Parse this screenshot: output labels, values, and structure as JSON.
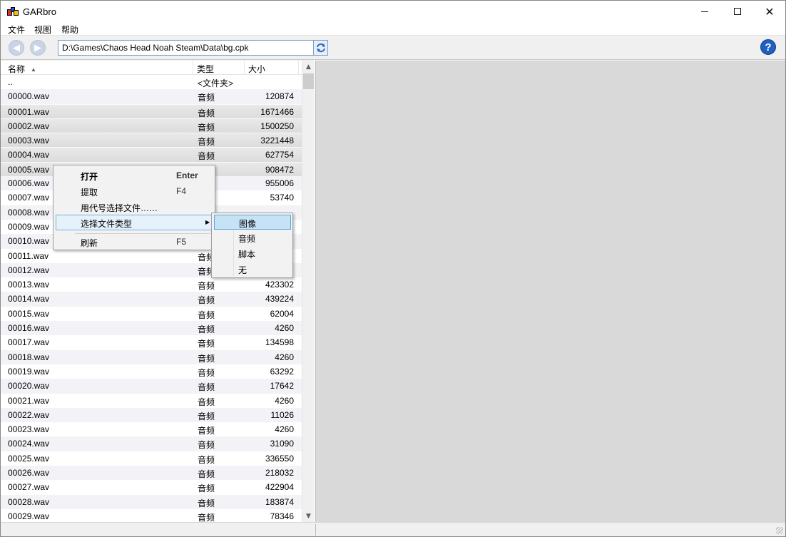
{
  "window": {
    "title": "GARbro"
  },
  "menubar": {
    "file": "文件",
    "view": "视图",
    "help": "帮助"
  },
  "toolbar": {
    "path": "D:\\Games\\Chaos Head Noah Steam\\Data\\bg.cpk"
  },
  "list": {
    "headers": {
      "name": "名称",
      "type": "类型",
      "size": "大小"
    },
    "rows": [
      {
        "name": "..",
        "type": "<文件夹>",
        "size": ""
      },
      {
        "name": "00000.wav",
        "type": "音频",
        "size": "120874"
      },
      {
        "name": "00001.wav",
        "type": "音频",
        "size": "1671466"
      },
      {
        "name": "00002.wav",
        "type": "音频",
        "size": "1500250"
      },
      {
        "name": "00003.wav",
        "type": "音频",
        "size": "3221448"
      },
      {
        "name": "00004.wav",
        "type": "音频",
        "size": "627754"
      },
      {
        "name": "00005.wav",
        "type": "",
        "size": "908472"
      },
      {
        "name": "00006.wav",
        "type": "",
        "size": "955006"
      },
      {
        "name": "00007.wav",
        "type": "",
        "size": "53740"
      },
      {
        "name": "00008.wav",
        "type": "",
        "size": ""
      },
      {
        "name": "00009.wav",
        "type": "",
        "size": ""
      },
      {
        "name": "00010.wav",
        "type": "",
        "size": ""
      },
      {
        "name": "00011.wav",
        "type": "音频",
        "size": ""
      },
      {
        "name": "00012.wav",
        "type": "音频",
        "size": ""
      },
      {
        "name": "00013.wav",
        "type": "音频",
        "size": "423302"
      },
      {
        "name": "00014.wav",
        "type": "音频",
        "size": "439224"
      },
      {
        "name": "00015.wav",
        "type": "音频",
        "size": "62004"
      },
      {
        "name": "00016.wav",
        "type": "音频",
        "size": "4260"
      },
      {
        "name": "00017.wav",
        "type": "音频",
        "size": "134598"
      },
      {
        "name": "00018.wav",
        "type": "音频",
        "size": "4260"
      },
      {
        "name": "00019.wav",
        "type": "音频",
        "size": "63292"
      },
      {
        "name": "00020.wav",
        "type": "音频",
        "size": "17642"
      },
      {
        "name": "00021.wav",
        "type": "音频",
        "size": "4260"
      },
      {
        "name": "00022.wav",
        "type": "音频",
        "size": "11026"
      },
      {
        "name": "00023.wav",
        "type": "音频",
        "size": "4260"
      },
      {
        "name": "00024.wav",
        "type": "音频",
        "size": "31090"
      },
      {
        "name": "00025.wav",
        "type": "音频",
        "size": "336550"
      },
      {
        "name": "00026.wav",
        "type": "音频",
        "size": "218032"
      },
      {
        "name": "00027.wav",
        "type": "音频",
        "size": "422904"
      },
      {
        "name": "00028.wav",
        "type": "音频",
        "size": "183874"
      },
      {
        "name": "00029.wav",
        "type": "音频",
        "size": "78346"
      }
    ]
  },
  "context_menu": {
    "open": "打开",
    "open_key": "Enter",
    "extract": "提取",
    "extract_key": "F4",
    "select_by_code": "用代号选择文件……",
    "select_type": "选择文件类型",
    "refresh": "刷新",
    "refresh_key": "F5"
  },
  "sub_menu": {
    "image": "图像",
    "audio": "音频",
    "script": "脚本",
    "none": "无"
  },
  "colors": {
    "selection_highlight": "#c6e2f5",
    "preview_bg": "#d9d9d9",
    "path_border": "#7a9cc9"
  },
  "icons": [
    "app-icon",
    "back-icon",
    "forward-icon",
    "refresh-icon",
    "help-icon",
    "sort-ascending-icon",
    "submenu-arrow-icon"
  ]
}
